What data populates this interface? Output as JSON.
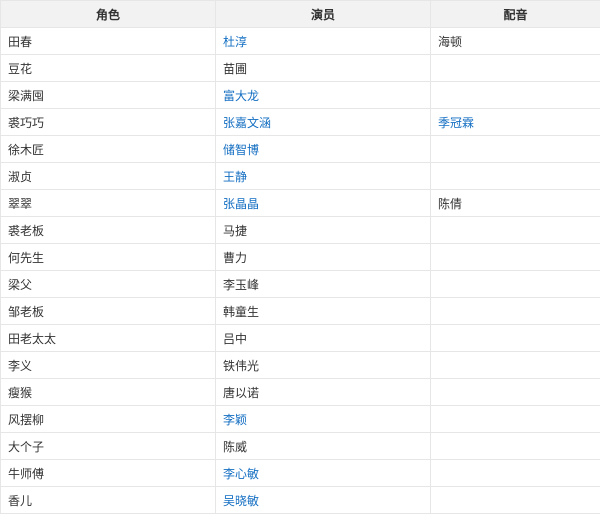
{
  "table": {
    "headers": [
      "角色",
      "演员",
      "配音"
    ],
    "rows": [
      {
        "role": "田春",
        "actor": "杜淳",
        "actor_link": true,
        "dub": "海顿",
        "dub_link": false
      },
      {
        "role": "豆花",
        "actor": "苗圃",
        "actor_link": false,
        "dub": "",
        "dub_link": false
      },
      {
        "role": "梁满囤",
        "actor": "富大龙",
        "actor_link": true,
        "dub": "",
        "dub_link": false
      },
      {
        "role": "裘巧巧",
        "actor": "张嘉文涵",
        "actor_link": true,
        "dub": "季冠霖",
        "dub_link": true
      },
      {
        "role": "徐木匠",
        "actor": "储智博",
        "actor_link": true,
        "dub": "",
        "dub_link": false
      },
      {
        "role": "淑贞",
        "actor": "王静",
        "actor_link": true,
        "dub": "",
        "dub_link": false
      },
      {
        "role": "翠翠",
        "actor": "张晶晶",
        "actor_link": true,
        "dub": "陈倩",
        "dub_link": false
      },
      {
        "role": "裘老板",
        "actor": "马捷",
        "actor_link": false,
        "dub": "",
        "dub_link": false
      },
      {
        "role": "何先生",
        "actor": "曹力",
        "actor_link": false,
        "dub": "",
        "dub_link": false
      },
      {
        "role": "梁父",
        "actor": "李玉峰",
        "actor_link": false,
        "dub": "",
        "dub_link": false
      },
      {
        "role": "邹老板",
        "actor": "韩童生",
        "actor_link": false,
        "dub": "",
        "dub_link": false
      },
      {
        "role": "田老太太",
        "actor": "吕中",
        "actor_link": false,
        "dub": "",
        "dub_link": false
      },
      {
        "role": "李义",
        "actor": "铁伟光",
        "actor_link": false,
        "dub": "",
        "dub_link": false
      },
      {
        "role": "瘦猴",
        "actor": "唐以诺",
        "actor_link": false,
        "dub": "",
        "dub_link": false
      },
      {
        "role": "风摆柳",
        "actor": "李颖",
        "actor_link": true,
        "dub": "",
        "dub_link": false
      },
      {
        "role": "大个子",
        "actor": "陈威",
        "actor_link": false,
        "dub": "",
        "dub_link": false
      },
      {
        "role": "牛师傅",
        "actor": "李心敏",
        "actor_link": true,
        "dub": "",
        "dub_link": false
      },
      {
        "role": "香儿",
        "actor": "吴晓敏",
        "actor_link": true,
        "dub": "",
        "dub_link": false
      }
    ]
  },
  "colors": {
    "link": "#136ec2",
    "text": "#333333",
    "header_bg": "#f2f2f2",
    "border": "#e6e6e6"
  }
}
